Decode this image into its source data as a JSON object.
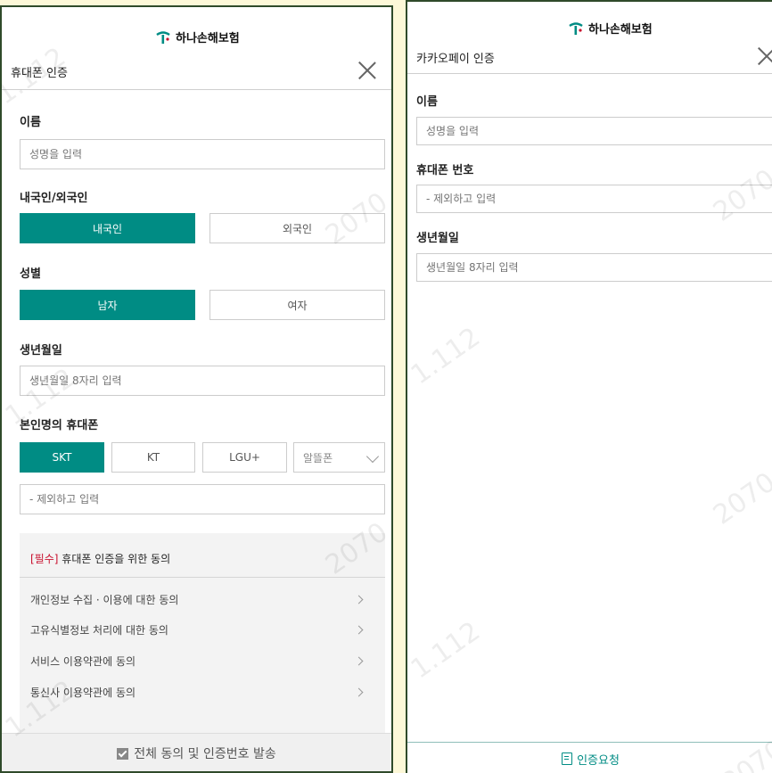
{
  "left": {
    "brand": "하나손해보험",
    "title": "휴대폰 인증",
    "name_label": "이름",
    "name_placeholder": "성명을 입력",
    "nationality_label": "내국인/외국인",
    "nationality_options": [
      "내국인",
      "외국인"
    ],
    "nationality_selected": "내국인",
    "gender_label": "성별",
    "gender_options": [
      "남자",
      "여자"
    ],
    "gender_selected": "남자",
    "birth_label": "생년월일",
    "birth_placeholder": "생년월일 8자리 입력",
    "phone_label": "본인명의 휴대폰",
    "carriers": [
      "SKT",
      "KT",
      "LGU+"
    ],
    "carrier_selected": "SKT",
    "mvno_select": "알뜰폰",
    "phone_placeholder": "- 제외하고 입력",
    "consent_required_tag": "[필수]",
    "consent_title": "휴대폰 인증을 위한 동의",
    "consent_items": [
      "개인정보 수집 · 이용에 대한 동의",
      "고유식별정보 처리에 대한 동의",
      "서비스 이용약관에 동의",
      "통신사 이용약관에 동의"
    ],
    "agree_all_button": "전체 동의 및 인증번호 발송"
  },
  "right": {
    "brand": "하나손해보험",
    "title": "카카오페이 인증",
    "name_label": "이름",
    "name_placeholder": "성명을 입력",
    "phone_label": "휴대폰 번호",
    "phone_placeholder": "- 제외하고 입력",
    "birth_label": "생년월일",
    "birth_placeholder": "생년월일 8자리 입력",
    "request_button": "인증요청"
  },
  "colors": {
    "accent": "#008c84",
    "required": "#c8102e",
    "background": "#fdf8d8",
    "frame": "#2f4a2a"
  },
  "icons": {
    "logo": "hana-logo-icon",
    "close": "close-icon",
    "select": "chevron-down-icon",
    "consent_item": "chevron-right-icon",
    "agree_all": "checkbox-icon",
    "request": "document-icon"
  }
}
